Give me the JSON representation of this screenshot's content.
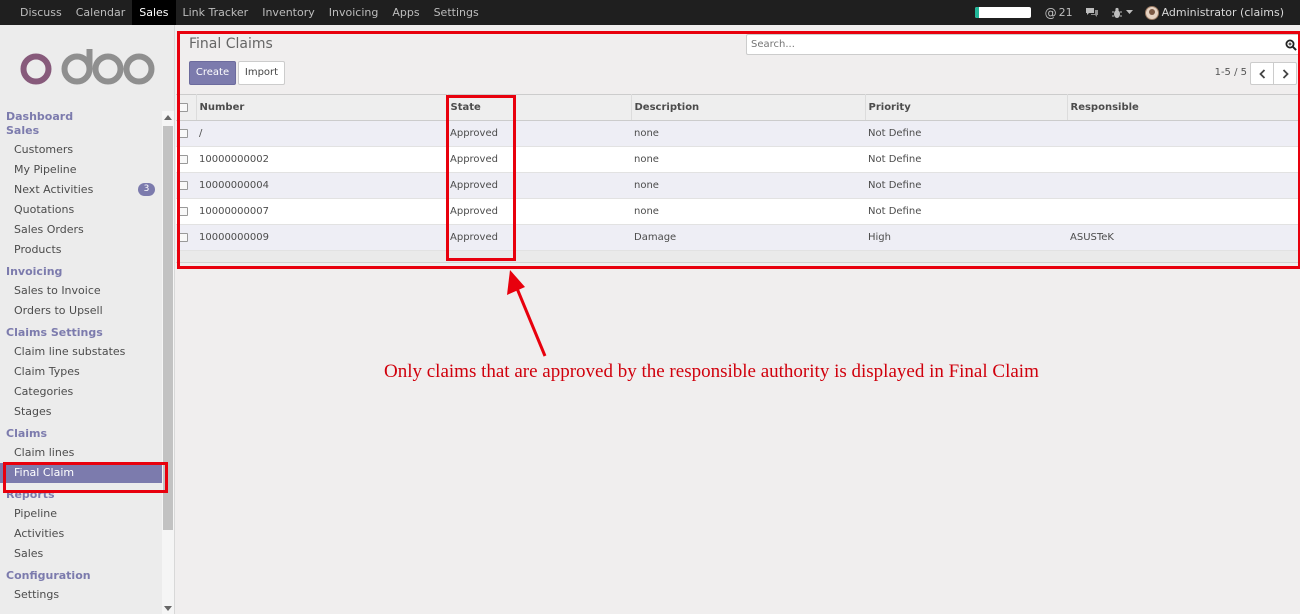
{
  "topbar": {
    "menu": [
      "Discuss",
      "Calendar",
      "Sales",
      "Link Tracker",
      "Inventory",
      "Invoicing",
      "Apps",
      "Settings"
    ],
    "active": "Sales",
    "progress_fraction": 0.08,
    "mentions_count": "21",
    "user": "Administrator (claims)"
  },
  "sidebar": {
    "logo_text": "odoo",
    "sections": [
      {
        "title": "Dashboard",
        "items": []
      },
      {
        "title": "Sales",
        "items": [
          {
            "label": "Customers"
          },
          {
            "label": "My Pipeline"
          },
          {
            "label": "Next Activities",
            "badge": "3"
          },
          {
            "label": "Quotations"
          },
          {
            "label": "Sales Orders"
          },
          {
            "label": "Products"
          }
        ]
      },
      {
        "title": "Invoicing",
        "items": [
          {
            "label": "Sales to Invoice"
          },
          {
            "label": "Orders to Upsell"
          }
        ]
      },
      {
        "title": "Claims Settings",
        "items": [
          {
            "label": "Claim line substates"
          },
          {
            "label": "Claim Types"
          },
          {
            "label": "Categories"
          },
          {
            "label": "Stages"
          }
        ]
      },
      {
        "title": "Claims",
        "items": [
          {
            "label": "Claim lines"
          },
          {
            "label": "Final Claim",
            "active": true
          }
        ]
      },
      {
        "title": "Reports",
        "items": [
          {
            "label": "Pipeline"
          },
          {
            "label": "Activities"
          },
          {
            "label": "Sales"
          }
        ]
      },
      {
        "title": "Configuration",
        "items": [
          {
            "label": "Settings"
          }
        ]
      }
    ]
  },
  "main": {
    "title": "Final Claims",
    "search_placeholder": "Search...",
    "create_label": "Create",
    "import_label": "Import",
    "pager": "1-5 / 5",
    "columns": [
      "Number",
      "State",
      "Description",
      "Priority",
      "Responsible"
    ],
    "rows": [
      [
        "/",
        "Approved",
        "none",
        "Not Define",
        ""
      ],
      [
        "10000000002",
        "Approved",
        "none",
        "Not Define",
        ""
      ],
      [
        "10000000004",
        "Approved",
        "none",
        "Not Define",
        ""
      ],
      [
        "10000000007",
        "Approved",
        "none",
        "Not Define",
        ""
      ],
      [
        "10000000009",
        "Approved",
        "Damage",
        "High",
        "ASUSTeK"
      ]
    ]
  },
  "annotation": {
    "text": "Only claims that are approved by the responsible authority is displayed in Final Claim",
    "color": "#e8000d"
  }
}
